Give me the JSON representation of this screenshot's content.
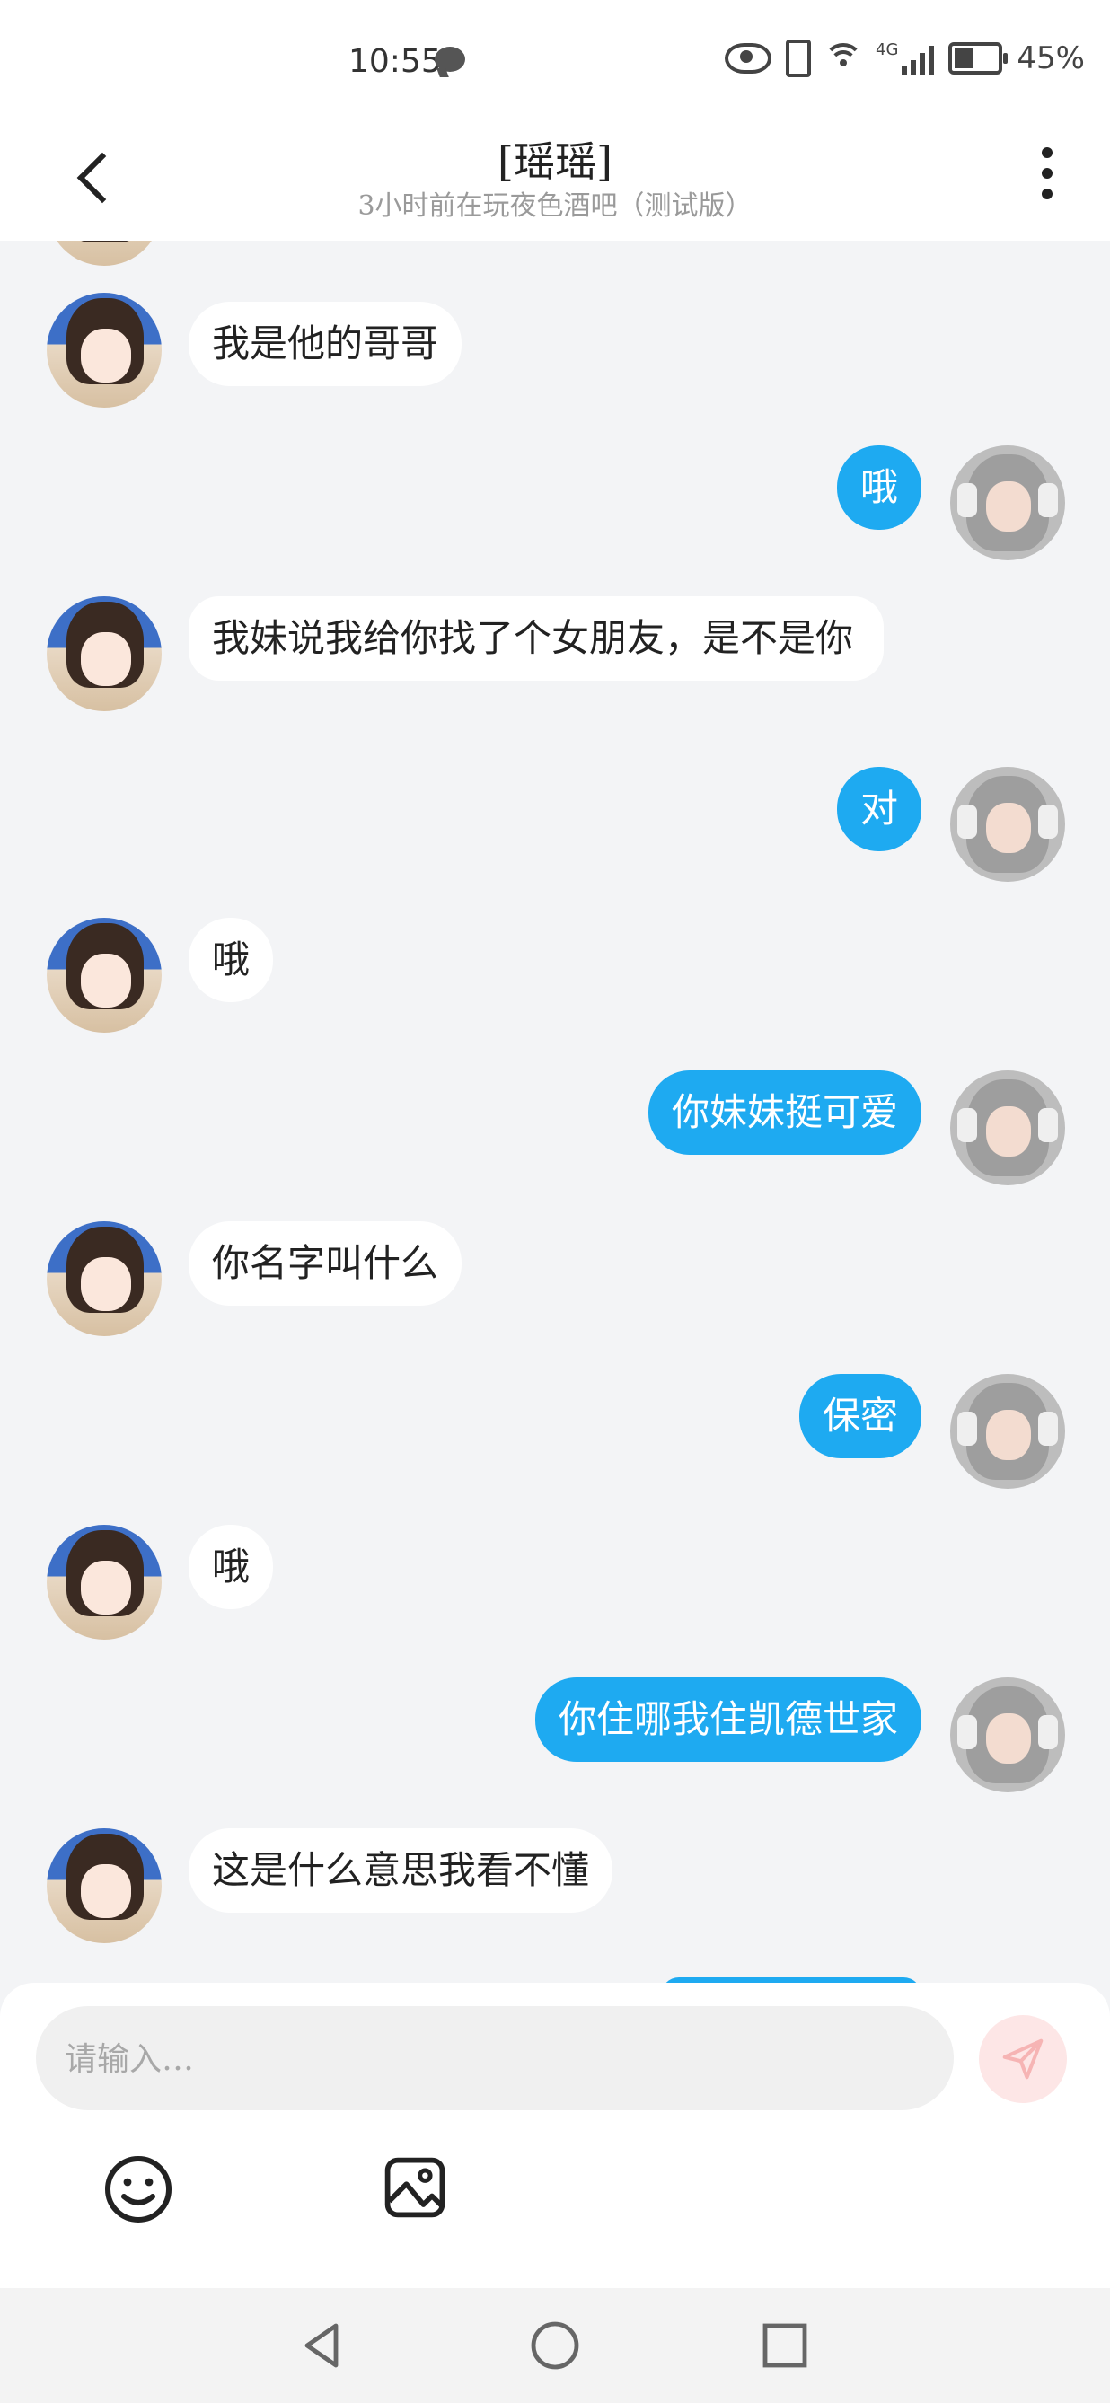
{
  "status_bar": {
    "time": "10:55",
    "battery": "45%",
    "network": "4G"
  },
  "header": {
    "title": "[瑶瑶]",
    "subtitle": "3小时前在玩夜色酒吧（测试版）"
  },
  "messages": [
    {
      "side": "in",
      "text": "我是他的哥哥"
    },
    {
      "side": "out",
      "text": "哦"
    },
    {
      "side": "in",
      "text": "我妹说我给你找了个女朋友，是不是你"
    },
    {
      "side": "out",
      "text": "对"
    },
    {
      "side": "in",
      "text": "哦"
    },
    {
      "side": "out",
      "text": "你妹妹挺可爱"
    },
    {
      "side": "in",
      "text": "你名字叫什么"
    },
    {
      "side": "out",
      "text": "保密"
    },
    {
      "side": "in",
      "text": "哦"
    },
    {
      "side": "out",
      "text": "你住哪我住凯德世家"
    },
    {
      "side": "in",
      "text": "这是什么意思我看不懂"
    }
  ],
  "composer": {
    "placeholder": "请输入…",
    "value": ""
  },
  "icons": {
    "back": "chevron-left-icon",
    "more": "more-vertical-icon",
    "send": "send-icon",
    "emoji": "emoji-icon",
    "image": "image-icon",
    "nav_back": "nav-back-icon",
    "nav_home": "nav-home-icon",
    "nav_recent": "nav-recent-icon"
  },
  "colors": {
    "outgoing_bubble": "#1eaaf1",
    "incoming_bubble": "#ffffff",
    "background": "#f3f4f6"
  }
}
